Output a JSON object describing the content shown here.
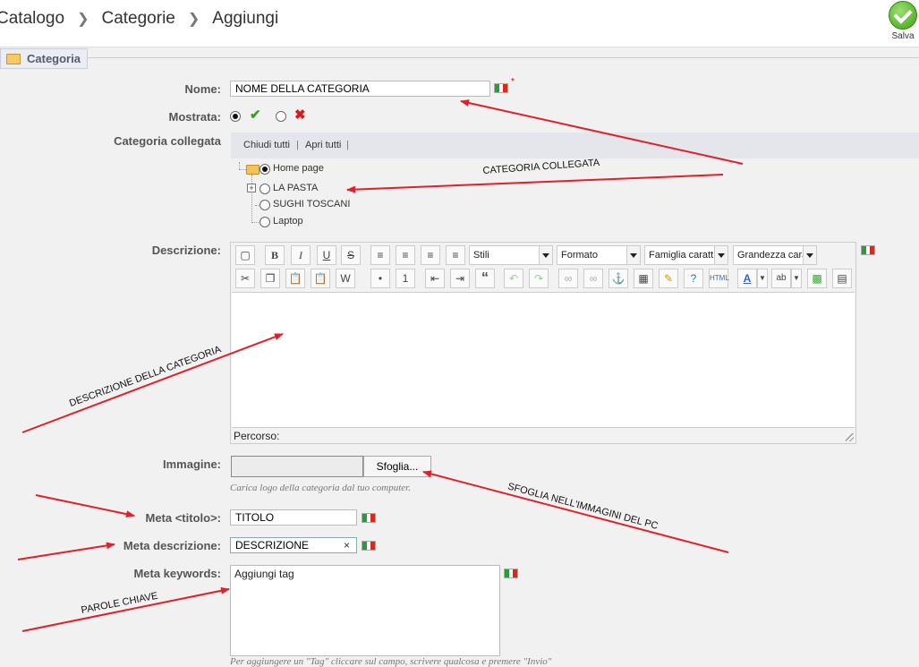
{
  "breadcrumb": [
    "Catalogo",
    "Categorie",
    "Aggiungi"
  ],
  "toolbar": {
    "save_label": "Salva"
  },
  "fieldset": {
    "legend": "Categoria"
  },
  "form": {
    "name_label": "Nome:",
    "name_value": "NOME DELLA CATEGORIA",
    "shown_label": "Mostrata:",
    "linked_label": "Categoria collegata",
    "collapse_all": "Chiudi tutti",
    "expand_all": "Apri tutti",
    "tree": [
      "Home page",
      "LA PASTA",
      "SUGHI TOSCANI",
      "Laptop"
    ],
    "description_label": "Descrizione:",
    "editor_styles": "Stili",
    "editor_format": "Formato",
    "editor_font_family": "Famiglia caratt",
    "editor_font_size": "Grandezza cara",
    "editor_path": "Percorso:",
    "image_label": "Immagine:",
    "browse_button": "Sfoglia...",
    "image_help": "Carica logo della categoria dal tuo computer.",
    "meta_title_label": "Meta <titolo>:",
    "meta_title_value": "TITOLO",
    "meta_desc_label": "Meta descrizione:",
    "meta_desc_value": "DESCRIZIONE",
    "meta_keywords_label": "Meta keywords:",
    "keywords_placeholder": "Aggiungi tag",
    "keywords_help": "Per aggiungere un \"Tag\" cliccare sul campo, scrivere qualcosa e premere \"Invio\""
  },
  "annotations": {
    "linked": "CATEGORIA COLLEGATA",
    "description": "DESCRIZIONE DELLA CATEGORIA",
    "browse": "SFOGLIA NELL'IMMAGINI DEL PC",
    "keywords": "PAROLE CHIAVE"
  },
  "colors": {
    "arrow": "#e0202a",
    "accent_green": "#39a11a",
    "required": "#cc0000"
  }
}
